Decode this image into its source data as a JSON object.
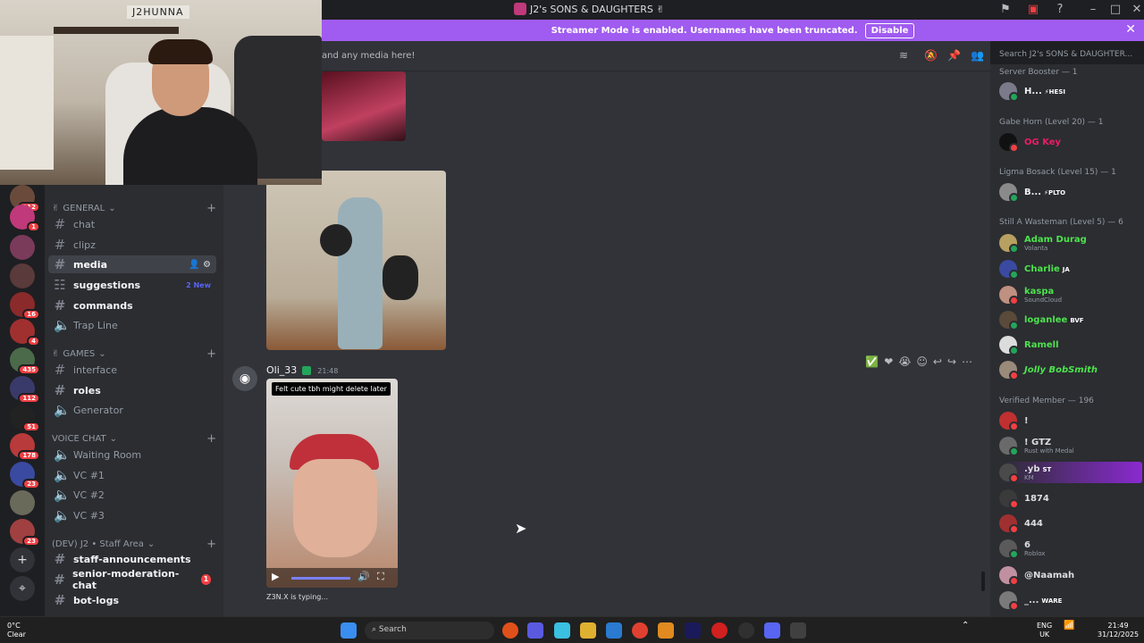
{
  "window": {
    "title": "J2's SONS & DAUGHTERS ✌",
    "accent": "#5865f2"
  },
  "webcam": {
    "overlay_text": "J2HUNNA"
  },
  "banner": {
    "text": "Streamer Mode is enabled. Usernames have been truncated.",
    "button": "Disable",
    "close_icon": "close-icon",
    "color": "#a05bf0"
  },
  "servers": {
    "badges": [
      "112",
      "1",
      "",
      "",
      "16",
      "4",
      "435",
      "112",
      "51",
      "178",
      "23",
      "",
      "23"
    ]
  },
  "sidebar": {
    "categories": [
      {
        "label": "GENERAL",
        "emoji": "✌"
      },
      {
        "label": "GAMES",
        "emoji": "✌"
      },
      {
        "label": "VOICE CHAT"
      },
      {
        "label": "(DEV) J2 • Staff Area"
      }
    ],
    "channels": [
      {
        "label": "chat",
        "icon": "hash"
      },
      {
        "label": "clipz",
        "icon": "hash"
      },
      {
        "label": "media",
        "icon": "hash"
      },
      {
        "label": "suggestions",
        "icon": "forum",
        "tail": "2 New"
      },
      {
        "label": "commands",
        "icon": "hash"
      },
      {
        "label": "Trap Line",
        "icon": "voice"
      },
      {
        "label": "interface",
        "icon": "hash"
      },
      {
        "label": "roles",
        "icon": "hash"
      },
      {
        "label": "Generator",
        "icon": "voice"
      },
      {
        "label": "Waiting Room",
        "icon": "voice"
      },
      {
        "label": "VC #1",
        "icon": "voice"
      },
      {
        "label": "VC #2",
        "icon": "voice"
      },
      {
        "label": "VC #3",
        "icon": "voice"
      },
      {
        "label": "staff-announcements",
        "icon": "hash"
      },
      {
        "label": "senior-moderation-chat",
        "icon": "hash",
        "badge": "1"
      },
      {
        "label": "bot-logs",
        "icon": "hash"
      }
    ]
  },
  "chat": {
    "topic": "and any media here!",
    "message": {
      "author": "Oli_33",
      "time": "21:48",
      "caption": "Felt cute tbh might delete later"
    },
    "typing": "Z3N.X is typing..."
  },
  "search": {
    "placeholder": "Search J2's SONS & DAUGHTER..."
  },
  "members": {
    "groups": [
      "Server Booster — 1",
      "Gabe Horn (Level 20) — 1",
      "Ligma Bosack (Level 15) — 1",
      "Still A Wasteman (Level 5) — 6",
      "Verified Member — 196"
    ],
    "list": [
      {
        "name": "H...",
        "tag": "⚡HESI",
        "color": "#f2f3f5"
      },
      {
        "name": "OG Key",
        "color": "#e91e63"
      },
      {
        "name": "B...",
        "tag": "⚡PLTO",
        "color": "#f2f3f5"
      },
      {
        "name": "Adam Durag",
        "sub": "Volanta",
        "color": "#4de34d"
      },
      {
        "name": "Charlie",
        "tag": "JA",
        "color": "#4de34d"
      },
      {
        "name": "kaspa",
        "sub": "SoundCloud",
        "color": "#4de34d"
      },
      {
        "name": "loganlee",
        "tag": "BVF",
        "color": "#4de34d"
      },
      {
        "name": "Ramell",
        "color": "#4de34d"
      },
      {
        "name": "Jolly BobSmith",
        "color": "#4de34d"
      },
      {
        "name": "!",
        "color": "#f2f3f5"
      },
      {
        "name": "! GTZ",
        "sub": "Rust with Medal",
        "color": "#f2f3f5"
      },
      {
        "name": ".yb",
        "tag": "ST",
        "sub": "KM",
        "color": "#f2f3f5"
      },
      {
        "name": "1874",
        "color": "#f2f3f5"
      },
      {
        "name": "444",
        "color": "#f2f3f5"
      },
      {
        "name": "6",
        "sub": "Roblox",
        "color": "#f2f3f5"
      },
      {
        "name": "@Naamah",
        "color": "#f2f3f5"
      },
      {
        "name": "_...",
        "tag": "WARE",
        "color": "#f2f3f5"
      }
    ]
  },
  "taskbar": {
    "weather_temp": "0°C",
    "weather_desc": "Clear",
    "search": "Search",
    "lang": "ENG",
    "region": "UK",
    "time": "21:49",
    "date": "31/12/2025"
  }
}
